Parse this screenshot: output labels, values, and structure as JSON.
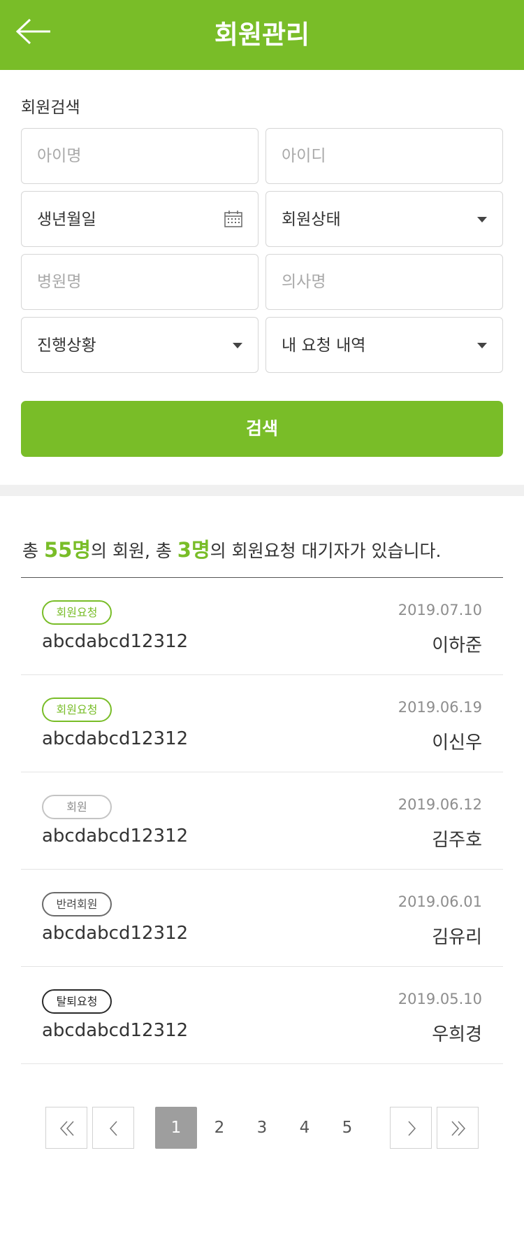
{
  "header": {
    "title": "회원관리"
  },
  "search": {
    "section_label": "회원검색",
    "child_name_placeholder": "아이명",
    "user_id_placeholder": "아이디",
    "birthdate_label": "생년월일",
    "member_status_value": "회원상태",
    "hospital_placeholder": "병원명",
    "doctor_placeholder": "의사명",
    "progress_value": "진행상황",
    "my_requests_value": "내 요청 내역",
    "search_button": "검색"
  },
  "summary": {
    "prefix": "총 ",
    "member_count": "55명",
    "middle": "의 회원, 총 ",
    "waiting_count": "3명",
    "suffix": "의 회원요청 대기자가 있습니다."
  },
  "members": [
    {
      "status": "회원요청",
      "date": "2019.07.10",
      "user_id": "abcdabcd12312",
      "name": "이하준"
    },
    {
      "status": "회원요청",
      "date": "2019.06.19",
      "user_id": "abcdabcd12312",
      "name": "이신우"
    },
    {
      "status": "회원",
      "date": "2019.06.12",
      "user_id": "abcdabcd12312",
      "name": "김주호"
    },
    {
      "status": "반려회원",
      "date": "2019.06.01",
      "user_id": "abcdabcd12312",
      "name": "김유리"
    },
    {
      "status": "탈퇴요청",
      "date": "2019.05.10",
      "user_id": "abcdabcd12312",
      "name": "우희경"
    }
  ],
  "pagination": {
    "pages": [
      "1",
      "2",
      "3",
      "4",
      "5"
    ],
    "current": "1"
  },
  "colors": {
    "accent": "#79bd28",
    "header_bg": "#79bd28",
    "active_page_bg": "#9e9e9e"
  }
}
